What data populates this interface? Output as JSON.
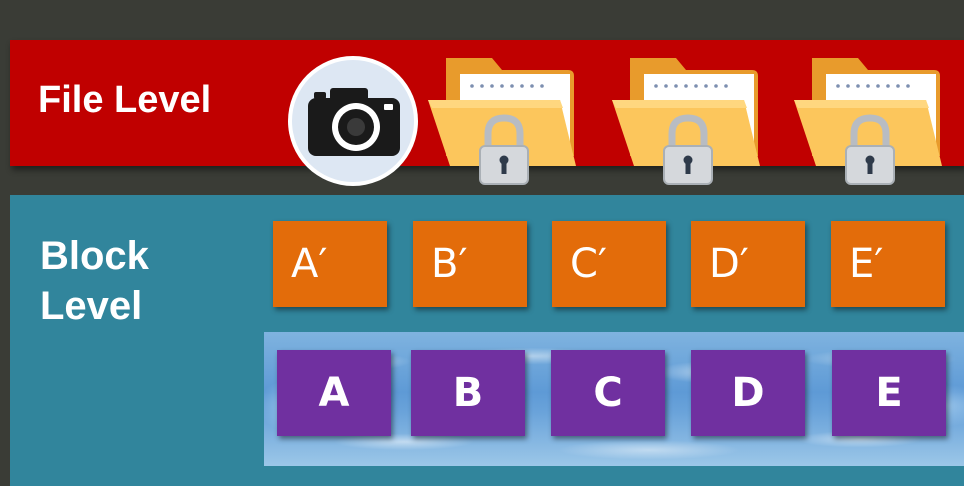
{
  "file_level": {
    "label": "File Level",
    "icons": [
      "camera-icon",
      "locked-folder-icon",
      "locked-folder-icon",
      "locked-folder-icon"
    ]
  },
  "block_level": {
    "label_line1": "Block",
    "label_line2": "Level",
    "modified_blocks": [
      "A′",
      "B′",
      "C′",
      "D′",
      "E′"
    ],
    "original_blocks": [
      "A",
      "B",
      "C",
      "D",
      "E"
    ]
  },
  "colors": {
    "file_band": "#c00000",
    "block_band": "#31859c",
    "modified_block": "#e36c0a",
    "original_block": "#7030a0"
  }
}
